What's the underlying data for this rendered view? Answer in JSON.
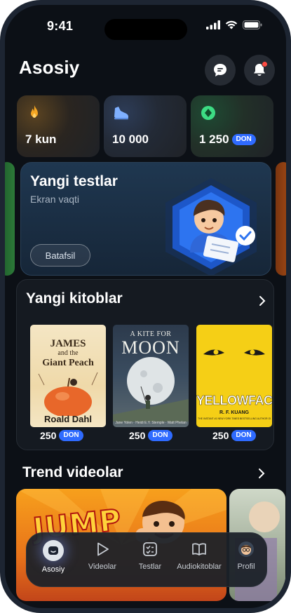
{
  "status": {
    "time": "9:41"
  },
  "header": {
    "title": "Asosiy"
  },
  "stats": [
    {
      "value": "7 kun",
      "icon": "flame-icon",
      "color": "#f5a623"
    },
    {
      "value": "10 000",
      "icon": "sneaker-icon",
      "color": "#7fb0ff"
    },
    {
      "value": "1 250",
      "currency": "DON",
      "icon": "gem-icon",
      "color": "#3ddc84"
    }
  ],
  "banner": {
    "title": "Yangi testlar",
    "subtitle": "Ekran vaqti",
    "button": "Batafsil"
  },
  "books": {
    "title": "Yangi kitoblar",
    "items": [
      {
        "title_line1": "JAMES",
        "title_line2": "and the",
        "title_line3": "Giant Peach",
        "author": "Roald Dahl",
        "price": "250",
        "currency": "DON"
      },
      {
        "title_line1": "A KITE FOR",
        "title_line2": "MOON",
        "author": "Jane Yolen · Heidi E.Y. Stemple · Matt Phelan",
        "price": "250",
        "currency": "DON"
      },
      {
        "title_line1": "YELLOWFACE",
        "author": "R. F. KUANG",
        "tagline": "THE INSTANT #1 NEW YORK TIMES BESTSELLING AUTHOR OF BABEL",
        "price": "250",
        "currency": "DON"
      }
    ]
  },
  "trend": {
    "title": "Trend videolar",
    "video_text": "JUMP"
  },
  "nav": [
    {
      "label": "Asosiy",
      "active": true
    },
    {
      "label": "Videolar"
    },
    {
      "label": "Testlar"
    },
    {
      "label": "Audiokitoblar"
    },
    {
      "label": "Profil"
    }
  ]
}
